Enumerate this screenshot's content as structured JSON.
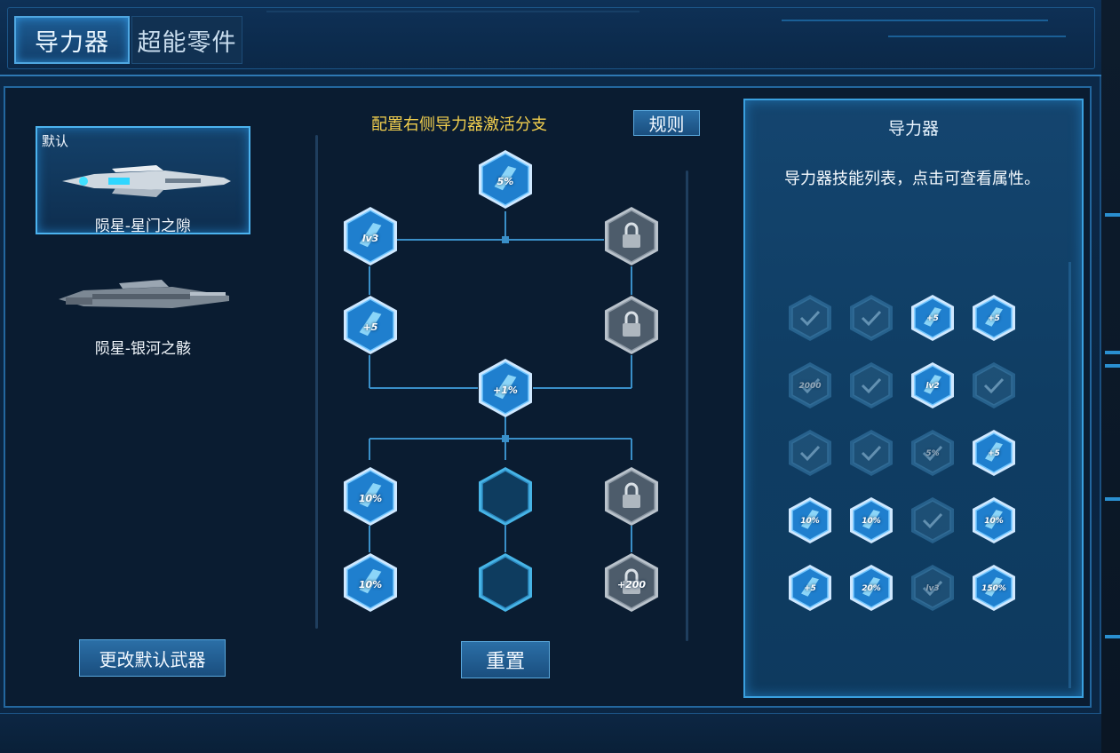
{
  "tabs": [
    {
      "label": "导力器",
      "active": true
    },
    {
      "label": "超能零件",
      "active": false
    }
  ],
  "weapons": [
    {
      "tag": "默认",
      "name": "陨星-星门之隙",
      "selected": true
    },
    {
      "tag": "",
      "name": "陨星-银河之骸",
      "selected": false
    }
  ],
  "buttons": {
    "change_default": "更改默认武器",
    "reset": "重置",
    "rules": "规则"
  },
  "config_title": "配置右侧导力器激活分支",
  "tree_nodes": [
    {
      "id": "top",
      "label": "5%",
      "state": "active",
      "icon": "sparkle-icon"
    },
    {
      "id": "l1",
      "label": "lv3",
      "state": "active",
      "icon": "sword-icon"
    },
    {
      "id": "r1",
      "label": "",
      "state": "locked",
      "icon": "lock-icon"
    },
    {
      "id": "l2",
      "label": "+5",
      "state": "active",
      "icon": "speed-icon"
    },
    {
      "id": "r2",
      "label": "",
      "state": "locked",
      "icon": "lock-icon"
    },
    {
      "id": "mid",
      "label": "+1%",
      "state": "active",
      "icon": "bolt-icon"
    },
    {
      "id": "l3",
      "label": "10%",
      "state": "active",
      "icon": "wing-icon"
    },
    {
      "id": "c3",
      "label": "",
      "state": "empty",
      "icon": "empty-slot"
    },
    {
      "id": "r3",
      "label": "",
      "state": "locked",
      "icon": "lock-icon"
    },
    {
      "id": "l4",
      "label": "10%",
      "state": "active",
      "icon": "wing-icon"
    },
    {
      "id": "c4",
      "label": "",
      "state": "empty",
      "icon": "empty-slot"
    },
    {
      "id": "r4",
      "label": "+200",
      "state": "locked",
      "icon": "lock-icon"
    }
  ],
  "reference": {
    "title": "导力器",
    "description": "导力器技能列表，点击可查看属性。",
    "icons": [
      {
        "label": "",
        "state": "dim",
        "icon": "check-icon"
      },
      {
        "label": "",
        "state": "dim",
        "icon": "check-icon"
      },
      {
        "label": "+5",
        "state": "active",
        "icon": "arrow-up-icon"
      },
      {
        "label": "+5",
        "state": "active",
        "icon": "arrow-up-icon"
      },
      {
        "label": "2000",
        "state": "dim",
        "icon": "check-icon"
      },
      {
        "label": "",
        "state": "dim",
        "icon": "check-icon"
      },
      {
        "label": "lv2",
        "state": "active",
        "icon": "sword-icon"
      },
      {
        "label": "",
        "state": "dim",
        "icon": "check-icon"
      },
      {
        "label": "",
        "state": "dim",
        "icon": "check-icon"
      },
      {
        "label": "",
        "state": "dim",
        "icon": "check-icon"
      },
      {
        "label": "5%",
        "state": "dim",
        "icon": "check-icon"
      },
      {
        "label": "+5",
        "state": "active",
        "icon": "plus-icon"
      },
      {
        "label": "10%",
        "state": "active",
        "icon": "wing-icon"
      },
      {
        "label": "10%",
        "state": "active",
        "icon": "sparkle-icon"
      },
      {
        "label": "",
        "state": "dim",
        "icon": "check-icon"
      },
      {
        "label": "10%",
        "state": "active",
        "icon": "shield-icon"
      },
      {
        "label": "+5",
        "state": "active",
        "icon": "speed-icon"
      },
      {
        "label": "20%",
        "state": "active",
        "icon": "gem-icon"
      },
      {
        "label": "lv3",
        "state": "dim",
        "icon": "sword-icon"
      },
      {
        "label": "150%",
        "state": "active",
        "icon": "bolt-icon"
      }
    ]
  }
}
